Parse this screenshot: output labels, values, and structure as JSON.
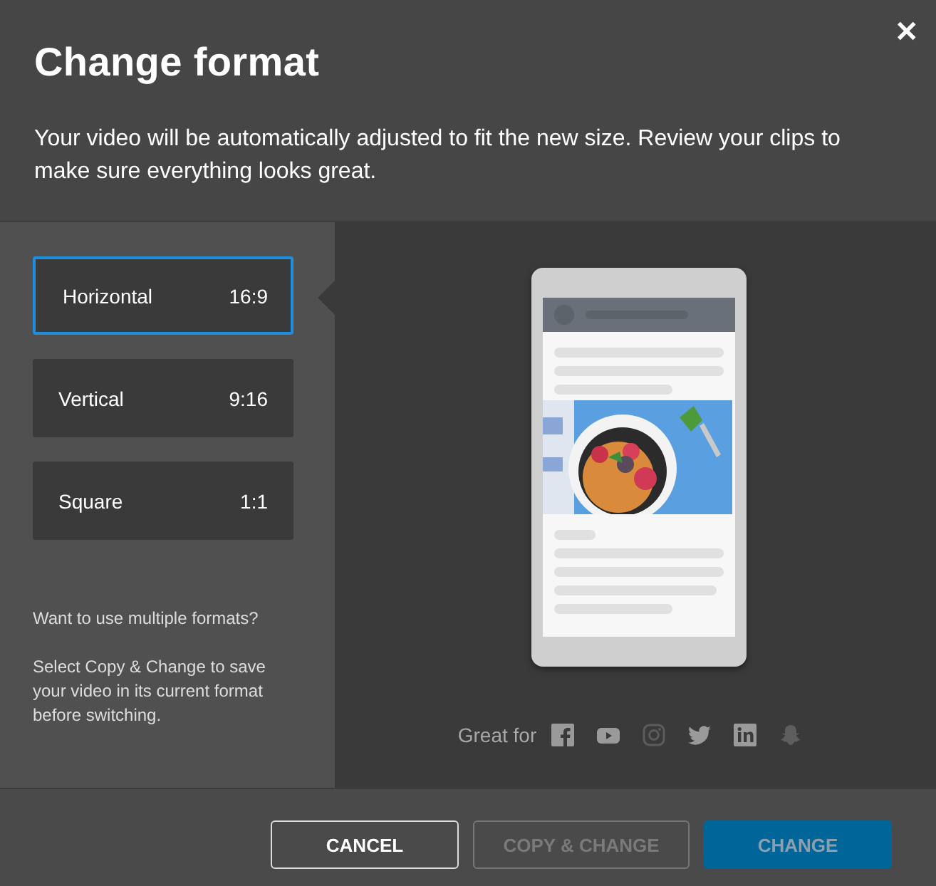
{
  "dialog": {
    "title": "Change format",
    "description": "Your video will be automatically adjusted to fit the new size. Review your clips to make sure everything looks great.",
    "close": "✕"
  },
  "formats": [
    {
      "name": "Horizontal",
      "ratio": "16:9",
      "selected": true
    },
    {
      "name": "Vertical",
      "ratio": "9:16",
      "selected": false
    },
    {
      "name": "Square",
      "ratio": "1:1",
      "selected": false
    }
  ],
  "hint": {
    "question": "Want to use multiple formats?",
    "text": "Select Copy & Change to save your video in its current format before switching."
  },
  "preview": {
    "great_for": "Great for"
  },
  "buttons": [
    {
      "label": "CANCEL",
      "kind": "secondary",
      "disabled": false
    },
    {
      "label": "COPY & CHANGE",
      "kind": "secondary",
      "disabled": true
    },
    {
      "label": "CHANGE",
      "kind": "primary",
      "disabled": true
    }
  ]
}
